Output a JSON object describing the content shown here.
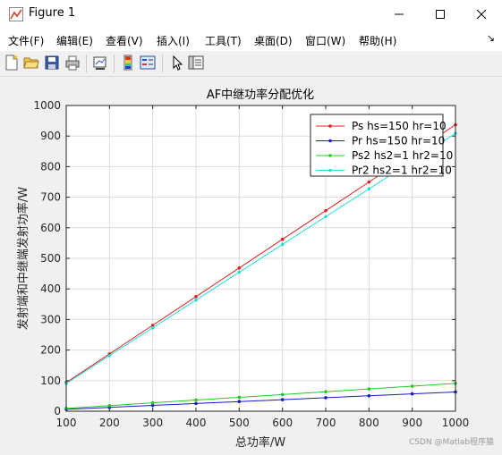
{
  "window": {
    "title": "Figure 1"
  },
  "menu": [
    "文件(F)",
    "编辑(E)",
    "查看(V)",
    "插入(I)",
    "工具(T)",
    "桌面(D)",
    "窗口(W)",
    "帮助(H)"
  ],
  "menu_arrow": "↘",
  "toolbar_icons": [
    "new-figure-icon",
    "open-icon",
    "save-icon",
    "print-icon",
    "link-plot-icon",
    "colorbar-icon",
    "legend-icon",
    "pointer-icon",
    "property-editor-icon"
  ],
  "watermark": "CSDN @Matlab程序猿",
  "chart_data": {
    "type": "line",
    "title": "AF中继功率分配优化",
    "xlabel": "总功率/W",
    "ylabel": "发射端和中继端发射功率/W",
    "xlim": [
      100,
      1000
    ],
    "ylim": [
      0,
      1000
    ],
    "xticks": [
      100,
      200,
      300,
      400,
      500,
      600,
      700,
      800,
      900,
      1000
    ],
    "yticks": [
      0,
      100,
      200,
      300,
      400,
      500,
      600,
      700,
      800,
      900,
      1000
    ],
    "grid": true,
    "legend_position": "top-right",
    "x": [
      100,
      200,
      300,
      400,
      500,
      600,
      700,
      800,
      900,
      1000
    ],
    "series": [
      {
        "name": "Ps hs=150 hr=10",
        "color": "#e02020",
        "marker": "dot",
        "values": [
          93.7,
          187.4,
          281.1,
          374.8,
          468.5,
          562.2,
          655.9,
          749.6,
          843.3,
          937.0
        ]
      },
      {
        "name": "Pr hs=150 hr=10",
        "color": "#1a1acc",
        "marker": "dot",
        "values": [
          6.3,
          12.6,
          18.9,
          25.2,
          31.5,
          37.8,
          44.1,
          50.4,
          56.7,
          63.0
        ]
      },
      {
        "name": "Ps2 hs2=1 hr2=10",
        "color": "#22cc22",
        "marker": "dot",
        "values": [
          9.1,
          18.2,
          27.3,
          36.4,
          45.5,
          54.6,
          63.7,
          72.8,
          81.9,
          91.0
        ]
      },
      {
        "name": "Pr2 hs2=1 hr2=10",
        "color": "#22dddd",
        "marker": "dot",
        "values": [
          90.9,
          181.8,
          272.7,
          363.6,
          454.5,
          545.4,
          636.3,
          727.2,
          818.1,
          909.0
        ]
      }
    ]
  }
}
